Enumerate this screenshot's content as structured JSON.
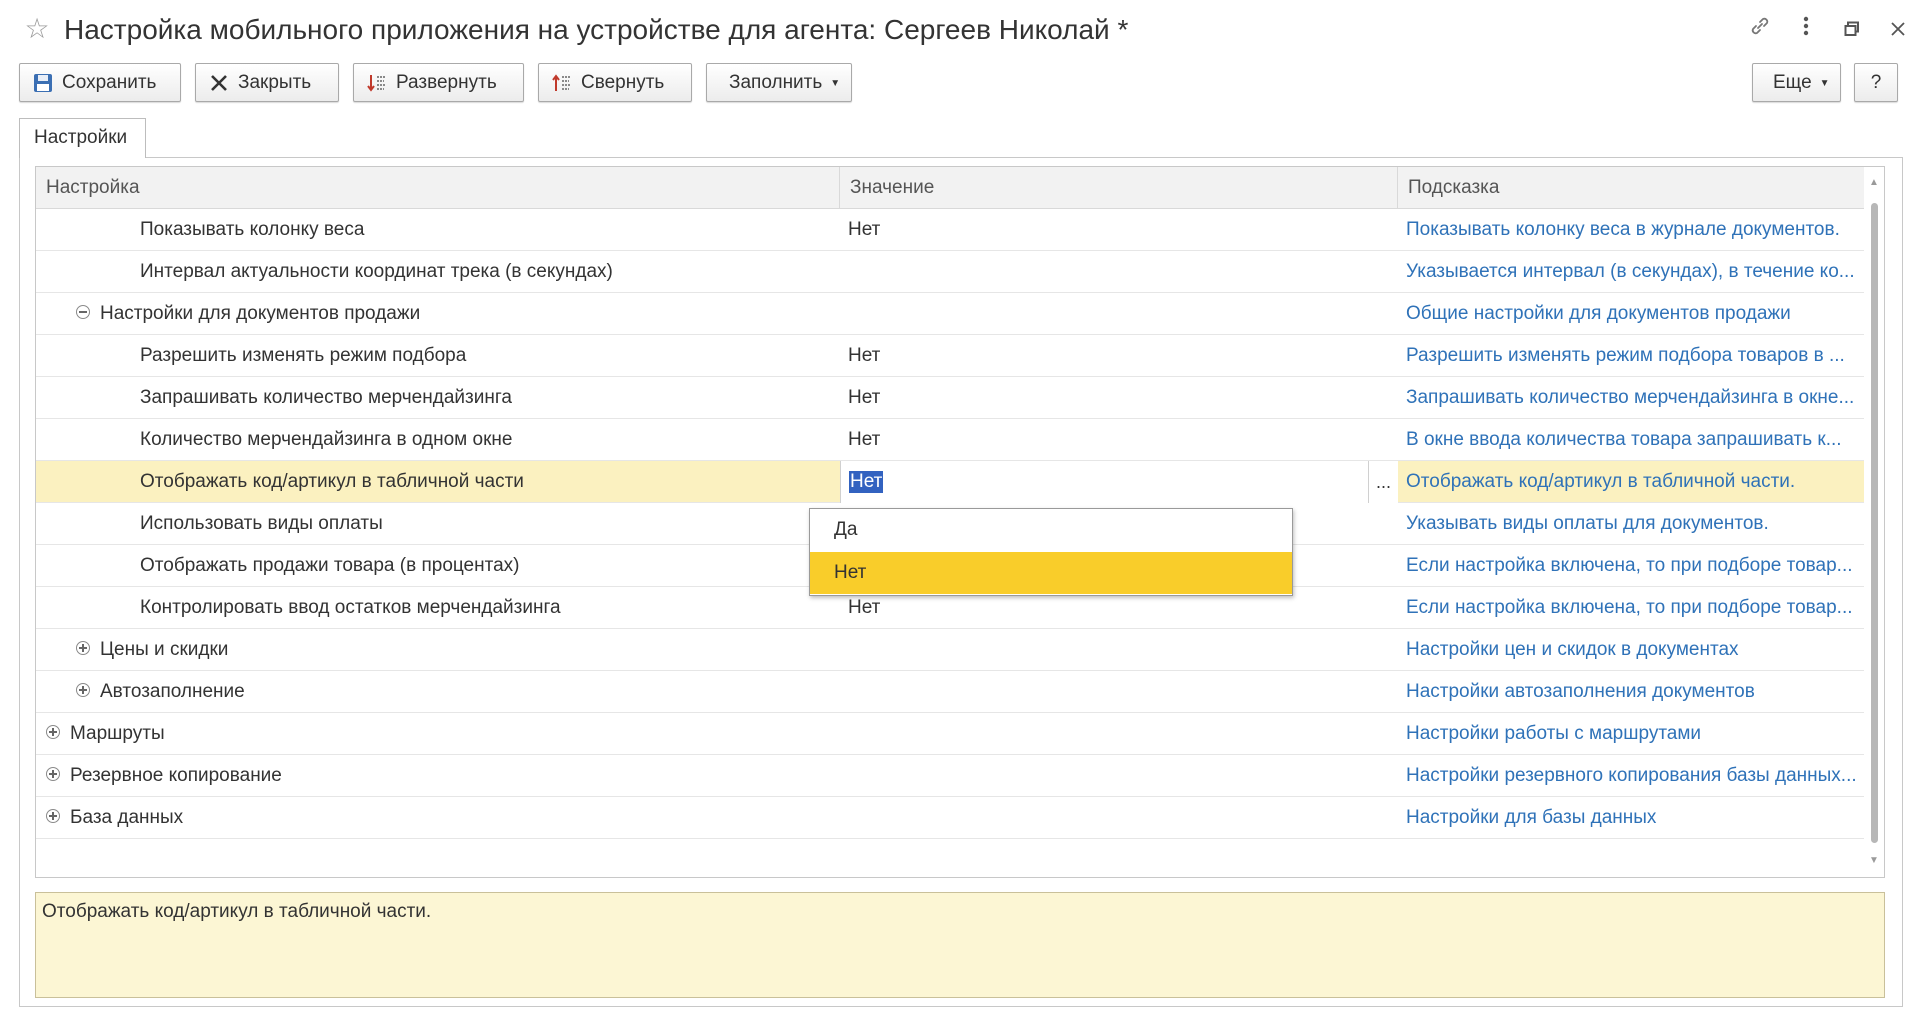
{
  "window": {
    "title": "Настройка мобильного приложения на устройстве для агента: Сергеев Николай *",
    "favorite_icon": "star-icon",
    "link_icon": "link-icon",
    "more_icon": "kebab-icon",
    "restore_icon": "restore-window-icon",
    "close_icon": "close-icon"
  },
  "toolbar": {
    "save_label": "Сохранить",
    "close_label": "Закрыть",
    "expand_label": "Развернуть",
    "collapse_label": "Свернуть",
    "fill_label": "Заполнить",
    "more_label": "Еще",
    "help_label": "?"
  },
  "tabs": [
    {
      "label": "Настройки",
      "active": true
    }
  ],
  "grid": {
    "columns": [
      "Настройка",
      "Значение",
      "Подсказка"
    ],
    "rows": [
      {
        "name": "Показывать колонку веса",
        "level": 2,
        "expander": "",
        "value": "Нет",
        "hint": "Показывать колонку веса в журнале документов."
      },
      {
        "name": "Интервал актуальности координат трека (в секундах)",
        "level": 2,
        "expander": "",
        "value": "",
        "hint": "Указывается интервал (в секундах), в течение ко..."
      },
      {
        "name": "Настройки для документов продажи",
        "level": 1,
        "expander": "minus",
        "value": "",
        "hint": "Общие настройки для документов продажи"
      },
      {
        "name": "Разрешить изменять режим подбора",
        "level": 2,
        "expander": "",
        "value": "Нет",
        "hint": "Разрешить изменять режим подбора товаров в ..."
      },
      {
        "name": "Запрашивать количество мерчендайзинга",
        "level": 2,
        "expander": "",
        "value": "Нет",
        "hint": "Запрашивать количество мерчендайзинга в окне..."
      },
      {
        "name": "Количество мерчендайзинга в одном окне",
        "level": 2,
        "expander": "",
        "value": "Нет",
        "hint": "В окне ввода количества товара запрашивать к..."
      },
      {
        "name": "Отображать код/артикул в табличной части",
        "level": 2,
        "expander": "",
        "value": "Нет",
        "hint": "Отображать код/артикул в табличной части.",
        "selected": true
      },
      {
        "name": "Использовать виды оплаты",
        "level": 2,
        "expander": "",
        "value": "",
        "hint": "Указывать виды оплаты для документов."
      },
      {
        "name": "Отображать продажи товара (в процентах)",
        "level": 2,
        "expander": "",
        "value": "",
        "hint": "Если настройка включена, то при подборе товар..."
      },
      {
        "name": "Контролировать ввод остатков мерчендайзинга",
        "level": 2,
        "expander": "",
        "value": "Нет",
        "hint": "Если настройка включена, то при подборе товар..."
      },
      {
        "name": "Цены и скидки",
        "level": 1,
        "expander": "plus",
        "value": "",
        "hint": "Настройки цен и скидок в документах"
      },
      {
        "name": "Автозаполнение",
        "level": 1,
        "expander": "plus",
        "value": "",
        "hint": "Настройки автозаполнения документов"
      },
      {
        "name": "Маршруты",
        "level": 0,
        "expander": "plus",
        "value": "",
        "hint": "Настройки работы с маршрутами"
      },
      {
        "name": "Резервное копирование",
        "level": 0,
        "expander": "plus",
        "value": "",
        "hint": "Настройки резервного копирования базы данных..."
      },
      {
        "name": "База данных",
        "level": 0,
        "expander": "plus",
        "value": "",
        "hint": "Настройки для базы данных"
      }
    ]
  },
  "editor": {
    "current_value": "Нет",
    "choice_button": "...",
    "options": [
      {
        "label": "Да",
        "active": false
      },
      {
        "label": "Нет",
        "active": true
      }
    ]
  },
  "hint_panel": {
    "text": "Отображать код/артикул в табличной части."
  },
  "colors": {
    "accent_link": "#2f72b8",
    "selected_row": "#fbf1c0",
    "dropdown_active": "#f9cd2a",
    "text_selection": "#3262c0",
    "hint_background": "#fcf6d4"
  }
}
